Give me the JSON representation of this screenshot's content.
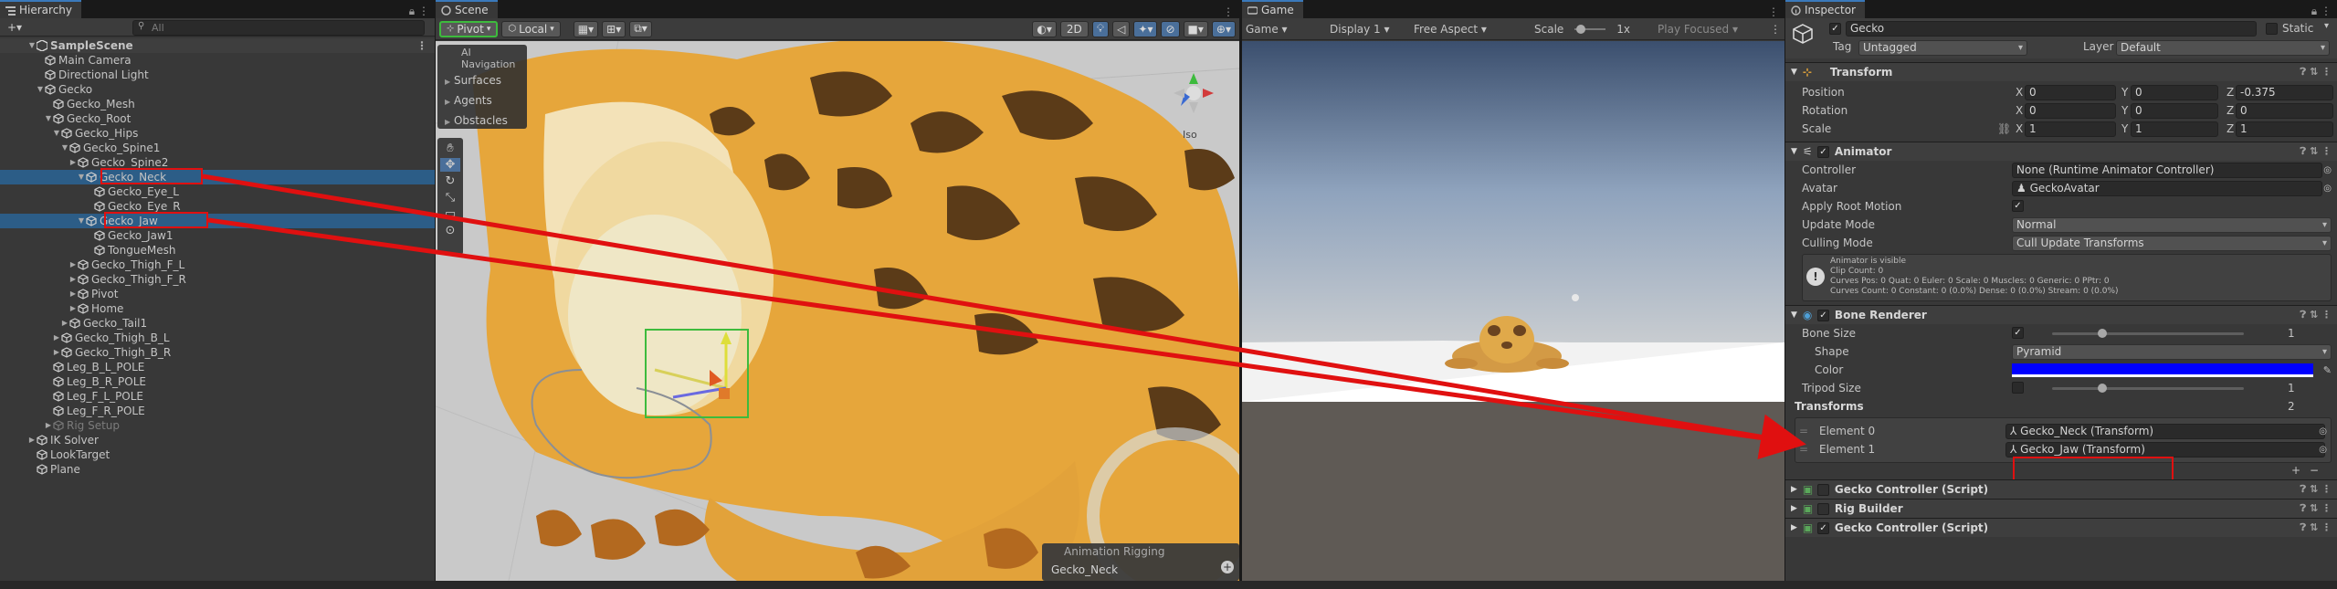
{
  "hierarchy": {
    "tab": "Hierarchy",
    "add_label": "+▾",
    "search_placeholder": "All",
    "scene_name": "SampleScene",
    "items": [
      {
        "label": "Main Camera"
      },
      {
        "label": "Directional Light"
      },
      {
        "label": "Gecko"
      },
      {
        "label": "Gecko_Mesh"
      },
      {
        "label": "Gecko_Root"
      },
      {
        "label": "Gecko_Hips"
      },
      {
        "label": "Gecko_Spine1"
      },
      {
        "label": "Gecko_Spine2"
      },
      {
        "label": "Gecko_Neck"
      },
      {
        "label": "Gecko_Eye_L"
      },
      {
        "label": "Gecko_Eye_R"
      },
      {
        "label": "Gecko_Jaw"
      },
      {
        "label": "Gecko_Jaw1"
      },
      {
        "label": "TongueMesh"
      },
      {
        "label": "Gecko_Thigh_F_L"
      },
      {
        "label": "Gecko_Thigh_F_R"
      },
      {
        "label": "Pivot"
      },
      {
        "label": "Home"
      },
      {
        "label": "Gecko_Tail1"
      },
      {
        "label": "Gecko_Thigh_B_L"
      },
      {
        "label": "Gecko_Thigh_B_R"
      },
      {
        "label": "Leg_B_L_POLE"
      },
      {
        "label": "Leg_B_R_POLE"
      },
      {
        "label": "Leg_F_L_POLE"
      },
      {
        "label": "Leg_F_R_POLE"
      },
      {
        "label": "Rig Setup"
      },
      {
        "label": "IK Solver"
      },
      {
        "label": "LookTarget"
      },
      {
        "label": "Plane"
      }
    ]
  },
  "scene": {
    "tab": "Scene",
    "pivot_label": "Pivot",
    "local_label": "Local",
    "mode_2d": "2D",
    "ai_nav_title": "AI Navigation",
    "ai_nav_items": [
      "Surfaces",
      "Agents",
      "Obstacles"
    ],
    "iso_label": "Iso",
    "anim_rigging_title": "Animation Rigging",
    "anim_rigging_value": "Gecko_Neck"
  },
  "game": {
    "tab": "Game",
    "game_dropdown": "Game",
    "display_dropdown": "Display 1",
    "aspect_dropdown": "Free Aspect",
    "scale_label": "Scale",
    "scale_value": "1x",
    "play_focused": "Play Focused"
  },
  "inspector": {
    "tab": "Inspector",
    "object_name": "Gecko",
    "static_label": "Static",
    "tag_label": "Tag",
    "tag_value": "Untagged",
    "layer_label": "Layer",
    "layer_value": "Default",
    "transform": {
      "title": "Transform",
      "position_label": "Position",
      "pos_x": "0",
      "pos_y": "0",
      "pos_z": "-0.375",
      "rotation_label": "Rotation",
      "rot_x": "0",
      "rot_y": "0",
      "rot_z": "0",
      "scale_label": "Scale",
      "scl_x": "1",
      "scl_y": "1",
      "scl_z": "1"
    },
    "animator": {
      "title": "Animator",
      "controller_label": "Controller",
      "controller_value": "None (Runtime Animator Controller)",
      "avatar_label": "Avatar",
      "avatar_value": "GeckoAvatar",
      "apply_root_label": "Apply Root Motion",
      "update_mode_label": "Update Mode",
      "update_mode_value": "Normal",
      "culling_label": "Culling Mode",
      "culling_value": "Cull Update Transforms",
      "info_lines": [
        "Animator is visible",
        "Clip Count: 0",
        "Curves Pos: 0 Quat: 0 Euler: 0 Scale: 0 Muscles: 0 Generic: 0 PPtr: 0",
        "Curves Count: 0 Constant: 0 (0.0%) Dense: 0 (0.0%) Stream: 0 (0.0%)"
      ]
    },
    "bone_renderer": {
      "title": "Bone Renderer",
      "bone_size_label": "Bone Size",
      "bone_size_value": "1",
      "shape_label": "Shape",
      "shape_value": "Pyramid",
      "color_label": "Color",
      "color": "#0000ff",
      "tripod_label": "Tripod Size",
      "tripod_value": "1",
      "transforms_label": "Transforms",
      "transforms_count": "2",
      "element0_label": "Element 0",
      "element0_value": "Gecko_Neck (Transform)",
      "element1_label": "Element 1",
      "element1_value": "Gecko_Jaw (Transform)"
    },
    "components": [
      "Gecko Controller (Script)",
      "Rig Builder",
      "Gecko Controller (Script)"
    ]
  },
  "colors": {
    "highlight_red": "#e01010",
    "selection_blue": "#2c5d87",
    "gecko_orange": "#e8a838",
    "gecko_spots": "#5a3a1a",
    "gizmo_green": "#3dbb3d"
  }
}
